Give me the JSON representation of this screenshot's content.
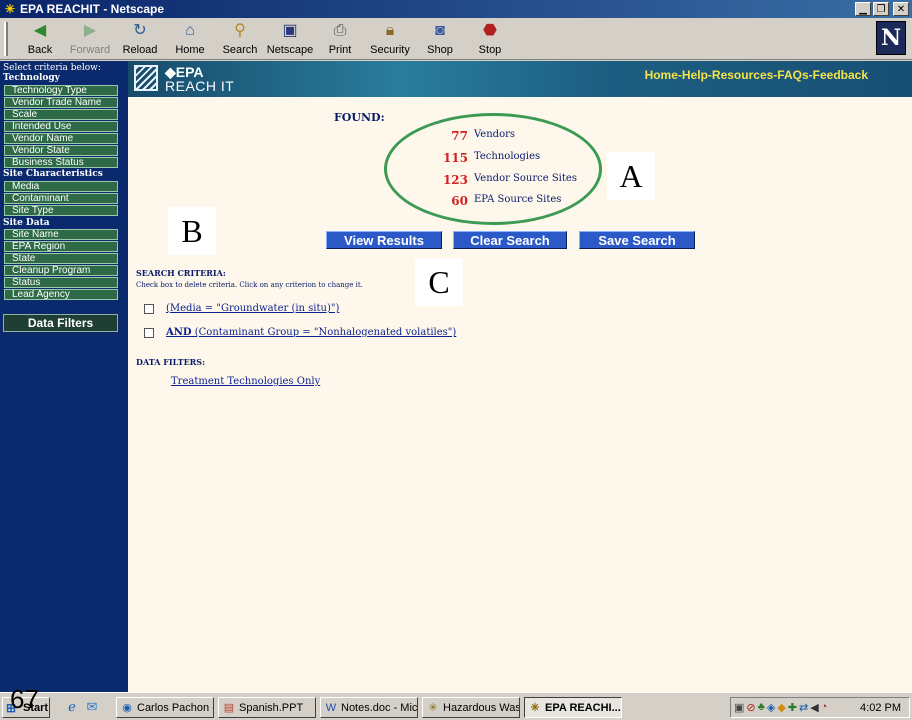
{
  "window": {
    "title": "EPA REACHIT - Netscape"
  },
  "toolbar": {
    "buttons": [
      {
        "label": "Back",
        "icon": "back-arrow-icon"
      },
      {
        "label": "Forward",
        "icon": "forward-arrow-icon"
      },
      {
        "label": "Reload",
        "icon": "reload-icon"
      },
      {
        "label": "Home",
        "icon": "home-icon"
      },
      {
        "label": "Search",
        "icon": "search-icon"
      },
      {
        "label": "Netscape",
        "icon": "my-netscape-icon"
      },
      {
        "label": "Print",
        "icon": "print-icon"
      },
      {
        "label": "Security",
        "icon": "lock-icon"
      },
      {
        "label": "Shop",
        "icon": "shop-icon"
      },
      {
        "label": "Stop",
        "icon": "stop-icon"
      }
    ],
    "logo": "N"
  },
  "sidebar": {
    "intro": "Select criteria below:",
    "sections": [
      {
        "title": "Technology",
        "items": [
          "Technology Type",
          "Vendor Trade Name",
          "Scale",
          "Intended Use",
          "Vendor Name",
          "Vendor State",
          "Business Status"
        ]
      },
      {
        "title": "Site Characteristics",
        "items": [
          "Media",
          "Contaminant",
          "Site Type"
        ]
      },
      {
        "title": "Site Data",
        "items": [
          "Site Name",
          "EPA Region",
          "State",
          "Cleanup Program",
          "Status",
          "Lead Agency"
        ]
      }
    ],
    "filter_button": "Data Filters"
  },
  "banner": {
    "brand_line1": "EPA",
    "brand_line2": "REACH IT",
    "links": [
      "Home",
      "Help",
      "Resources",
      "FAQs",
      "Feedback"
    ],
    "separator": " - "
  },
  "results": {
    "found_label": "FOUND:",
    "stats": [
      {
        "count": "77",
        "label": "Vendors"
      },
      {
        "count": "115",
        "label": "Technologies"
      },
      {
        "count": "123",
        "label": "Vendor Source Sites"
      },
      {
        "count": "60",
        "label": "EPA Source Sites"
      }
    ]
  },
  "annotations": {
    "a": "A",
    "b": "B",
    "c": "C"
  },
  "actions": {
    "view": "View Results",
    "clear": "Clear Search",
    "save": "Save Search"
  },
  "criteria": {
    "title": "SEARCH CRITERIA:",
    "help": "Check box to delete criteria. Click on any criterion to change it.",
    "items": [
      {
        "prefix": "",
        "text": "(Media = \"Groundwater (in situ)\")"
      },
      {
        "prefix": "AND",
        "text": " (Contaminant Group = \"Nonhalogenated volatiles\")"
      }
    ]
  },
  "data_filters": {
    "title": "DATA FILTERS:",
    "link": "Treatment Technologies Only"
  },
  "slide_number": "67",
  "taskbar": {
    "start": "Start",
    "tasks": [
      {
        "label": "Carlos Pachon - ...",
        "icon": "outlook-icon"
      },
      {
        "label": "Spanish.PPT",
        "icon": "powerpoint-icon"
      },
      {
        "label": "Notes.doc - Micr...",
        "icon": "word-icon"
      },
      {
        "label": "Hazardous Was...",
        "icon": "netscape-icon"
      },
      {
        "label": "EPA REACHI...",
        "icon": "netscape-icon"
      }
    ],
    "clock": "4:02 PM"
  }
}
